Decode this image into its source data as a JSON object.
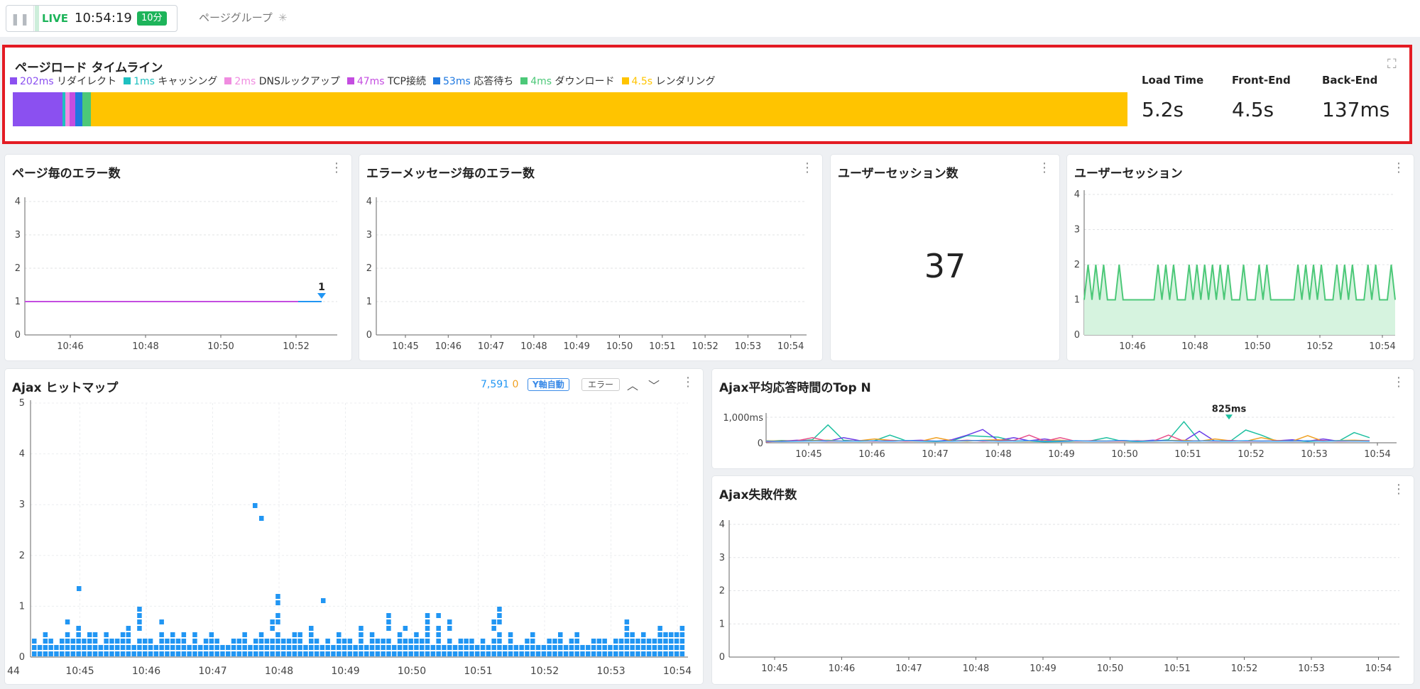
{
  "topbar": {
    "live_label": "LIVE",
    "time": "10:54:19",
    "interval_badge": "10分",
    "page_group": "ページグループ",
    "page_group_icon": "asterisk-icon"
  },
  "timeline": {
    "title": "ページロード タイムライン",
    "segments": [
      {
        "value": "202ms",
        "label": "リダイレクト",
        "color": "#8b50f0"
      },
      {
        "value": "1ms",
        "label": "キャッシング",
        "color": "#1ec0c0"
      },
      {
        "value": "2ms",
        "label": "DNSルックアップ",
        "color": "#f08ce0"
      },
      {
        "value": "47ms",
        "label": "TCP接続",
        "color": "#c44de0"
      },
      {
        "value": "53ms",
        "label": "応答待ち",
        "color": "#1e78e0"
      },
      {
        "value": "4ms",
        "label": "ダウンロード",
        "color": "#4cc878"
      },
      {
        "value": "4.5s",
        "label": "レンダリング",
        "color": "#ffc400"
      }
    ],
    "metrics": [
      {
        "label": "Load Time",
        "value": "5.2s"
      },
      {
        "label": "Front-End",
        "value": "4.5s"
      },
      {
        "label": "Back-End",
        "value": "137ms"
      }
    ]
  },
  "panels": {
    "page_errors": "ページ毎のエラー数",
    "message_errors": "エラーメッセージ毎のエラー数",
    "session_count": "ユーザーセッション数",
    "sessions": "ユーザーセッション",
    "ajax_heatmap": "Ajax ヒットマップ",
    "ajax_topn": "Ajax平均応答時間のTop N",
    "ajax_fail": "Ajax失敗件数"
  },
  "session_count_value": "37",
  "heatmap_controls": {
    "count_blue": "7,591",
    "count_orange": "0",
    "yaxis_button": "Y軸自動",
    "error_button": "エラー",
    "up_icon": "chevron-up-icon",
    "down_icon": "chevron-down-icon"
  },
  "colors": {
    "accent_blue": "#2196f3",
    "green": "#1db45a",
    "red_highlight": "#e31b23"
  },
  "chart_data": [
    {
      "id": "page_errors",
      "type": "line",
      "title": "ページ毎のエラー数",
      "x": [
        "10:44:20",
        "10:46",
        "10:48",
        "10:50",
        "10:52",
        "10:54"
      ],
      "series": [
        {
          "values": [
            1,
            1,
            1,
            1,
            1,
            1
          ],
          "color": "#c44de0"
        }
      ],
      "annotations": [
        {
          "x": "10:54",
          "y": 1,
          "text": "1"
        }
      ],
      "yticks": [
        0,
        1,
        2,
        3,
        4
      ],
      "xticks": [
        "10:46",
        "10:48",
        "10:50",
        "10:52",
        "10:54"
      ],
      "ylim": [
        0,
        4
      ],
      "grid": true
    },
    {
      "id": "message_errors",
      "type": "line",
      "title": "エラーメッセージ毎のエラー数",
      "series": [],
      "yticks": [
        0,
        1,
        2,
        3,
        4
      ],
      "xticks": [
        "10:45",
        "10:46",
        "10:47",
        "10:48",
        "10:49",
        "10:50",
        "10:51",
        "10:52",
        "10:53",
        "10:54"
      ],
      "ylim": [
        0,
        4
      ],
      "grid": true
    },
    {
      "id": "sessions",
      "type": "area",
      "title": "ユーザーセッション",
      "xticks": [
        "10:46",
        "10:48",
        "10:50",
        "10:52",
        "10:54"
      ],
      "yticks": [
        0,
        1,
        2,
        3,
        4
      ],
      "ylim": [
        0,
        4
      ],
      "series": [
        {
          "values": [
            1,
            2,
            1,
            2,
            1,
            2,
            1,
            1,
            1,
            2,
            1,
            1,
            1,
            1,
            1,
            1,
            1,
            1,
            1,
            2,
            1,
            2,
            1,
            2,
            1,
            1,
            1,
            2,
            1,
            2,
            1,
            2,
            1,
            2,
            1,
            2,
            1,
            2,
            1,
            1,
            1,
            2,
            1,
            1,
            1,
            2,
            1,
            2,
            1,
            1,
            1,
            1,
            1,
            1,
            1,
            2,
            1,
            2,
            1,
            2,
            1,
            2,
            1,
            1,
            1,
            2,
            1,
            2,
            1,
            2,
            1,
            1,
            1,
            2,
            1,
            2,
            1,
            1,
            1,
            2,
            1
          ],
          "color": "#4cc878"
        }
      ]
    },
    {
      "id": "ajax_heatmap",
      "type": "scatter",
      "title": "Ajax ヒットマップ",
      "xticks": [
        "44",
        "10:45",
        "10:46",
        "10:47",
        "10:48",
        "10:49",
        "10:50",
        "10:51",
        "10:52",
        "10:53",
        "10:54"
      ],
      "yticks": [
        0,
        1,
        2,
        3,
        4,
        5
      ],
      "ylim": [
        0,
        5
      ],
      "outliers": [
        {
          "x": "10:47:40",
          "y": 3.05
        },
        {
          "x": "10:47:45",
          "y": 2.8
        },
        {
          "x": "10:45:00",
          "y": 1.4
        },
        {
          "x": "10:48:40",
          "y": 1.15
        }
      ]
    },
    {
      "id": "ajax_topn",
      "type": "line",
      "title": "Ajax平均応答時間のTop N",
      "xticks": [
        "10:45",
        "10:46",
        "10:47",
        "10:48",
        "10:49",
        "10:50",
        "10:51",
        "10:52",
        "10:53",
        "10:54"
      ],
      "yticks": [
        "0",
        "1,000ms"
      ],
      "ylim": [
        0,
        1000
      ],
      "annotations": [
        {
          "x": "10:51:45",
          "y": 825,
          "text": "825ms"
        }
      ],
      "series": [
        {
          "color": "#1ec0a0",
          "values": [
            60,
            90,
            70,
            120,
            700,
            100,
            60,
            80,
            300,
            90,
            60,
            50,
            70,
            280,
            250,
            220,
            70,
            60,
            40,
            50,
            60,
            80,
            200,
            60,
            50,
            60,
            120,
            825,
            80,
            70,
            60,
            500,
            300,
            60,
            80,
            50,
            80,
            60,
            400,
            200
          ]
        },
        {
          "color": "#6a3de8",
          "values": [
            50,
            60,
            100,
            80,
            60,
            200,
            90,
            70,
            60,
            80,
            100,
            60,
            120,
            300,
            520,
            90,
            200,
            80,
            150,
            60,
            80,
            70,
            60,
            90,
            60,
            100,
            80,
            70,
            450,
            60,
            80,
            70,
            60,
            80,
            120,
            60,
            150,
            60,
            80,
            70
          ]
        },
        {
          "color": "#f0a020",
          "values": [
            80,
            70,
            60,
            90,
            100,
            60,
            80,
            150,
            100,
            70,
            60,
            200,
            80,
            60,
            100,
            120,
            80,
            60,
            90,
            100,
            60,
            80,
            70,
            60,
            80,
            60,
            90,
            100,
            60,
            150,
            80,
            60,
            200,
            90,
            60,
            280,
            60,
            90,
            100,
            80
          ]
        },
        {
          "color": "#e84e8a",
          "values": [
            40,
            60,
            80,
            200,
            60,
            70,
            80,
            60,
            90,
            60,
            80,
            60,
            70,
            100,
            60,
            80,
            90,
            300,
            60,
            200,
            60,
            80,
            60,
            70,
            80,
            60,
            300,
            60,
            80,
            60,
            90,
            60,
            70,
            80,
            60,
            80,
            90,
            60,
            70,
            80
          ]
        },
        {
          "color": "#3aa0f0",
          "values": [
            70,
            50,
            60,
            70,
            80,
            60,
            70,
            80,
            60,
            90,
            60,
            70,
            60,
            80,
            90,
            60,
            70,
            80,
            60,
            70,
            80,
            60,
            70,
            90,
            60,
            70,
            80,
            60,
            70,
            80,
            60,
            80,
            70,
            60,
            70,
            80,
            60,
            80,
            70,
            60
          ]
        }
      ]
    },
    {
      "id": "ajax_fail",
      "type": "line",
      "title": "Ajax失敗件数",
      "series": [],
      "xticks": [
        "10:45",
        "10:46",
        "10:47",
        "10:48",
        "10:49",
        "10:50",
        "10:51",
        "10:52",
        "10:53",
        "10:54"
      ],
      "yticks": [
        0,
        1,
        2,
        3,
        4
      ],
      "ylim": [
        0,
        4
      ],
      "grid": true
    }
  ]
}
